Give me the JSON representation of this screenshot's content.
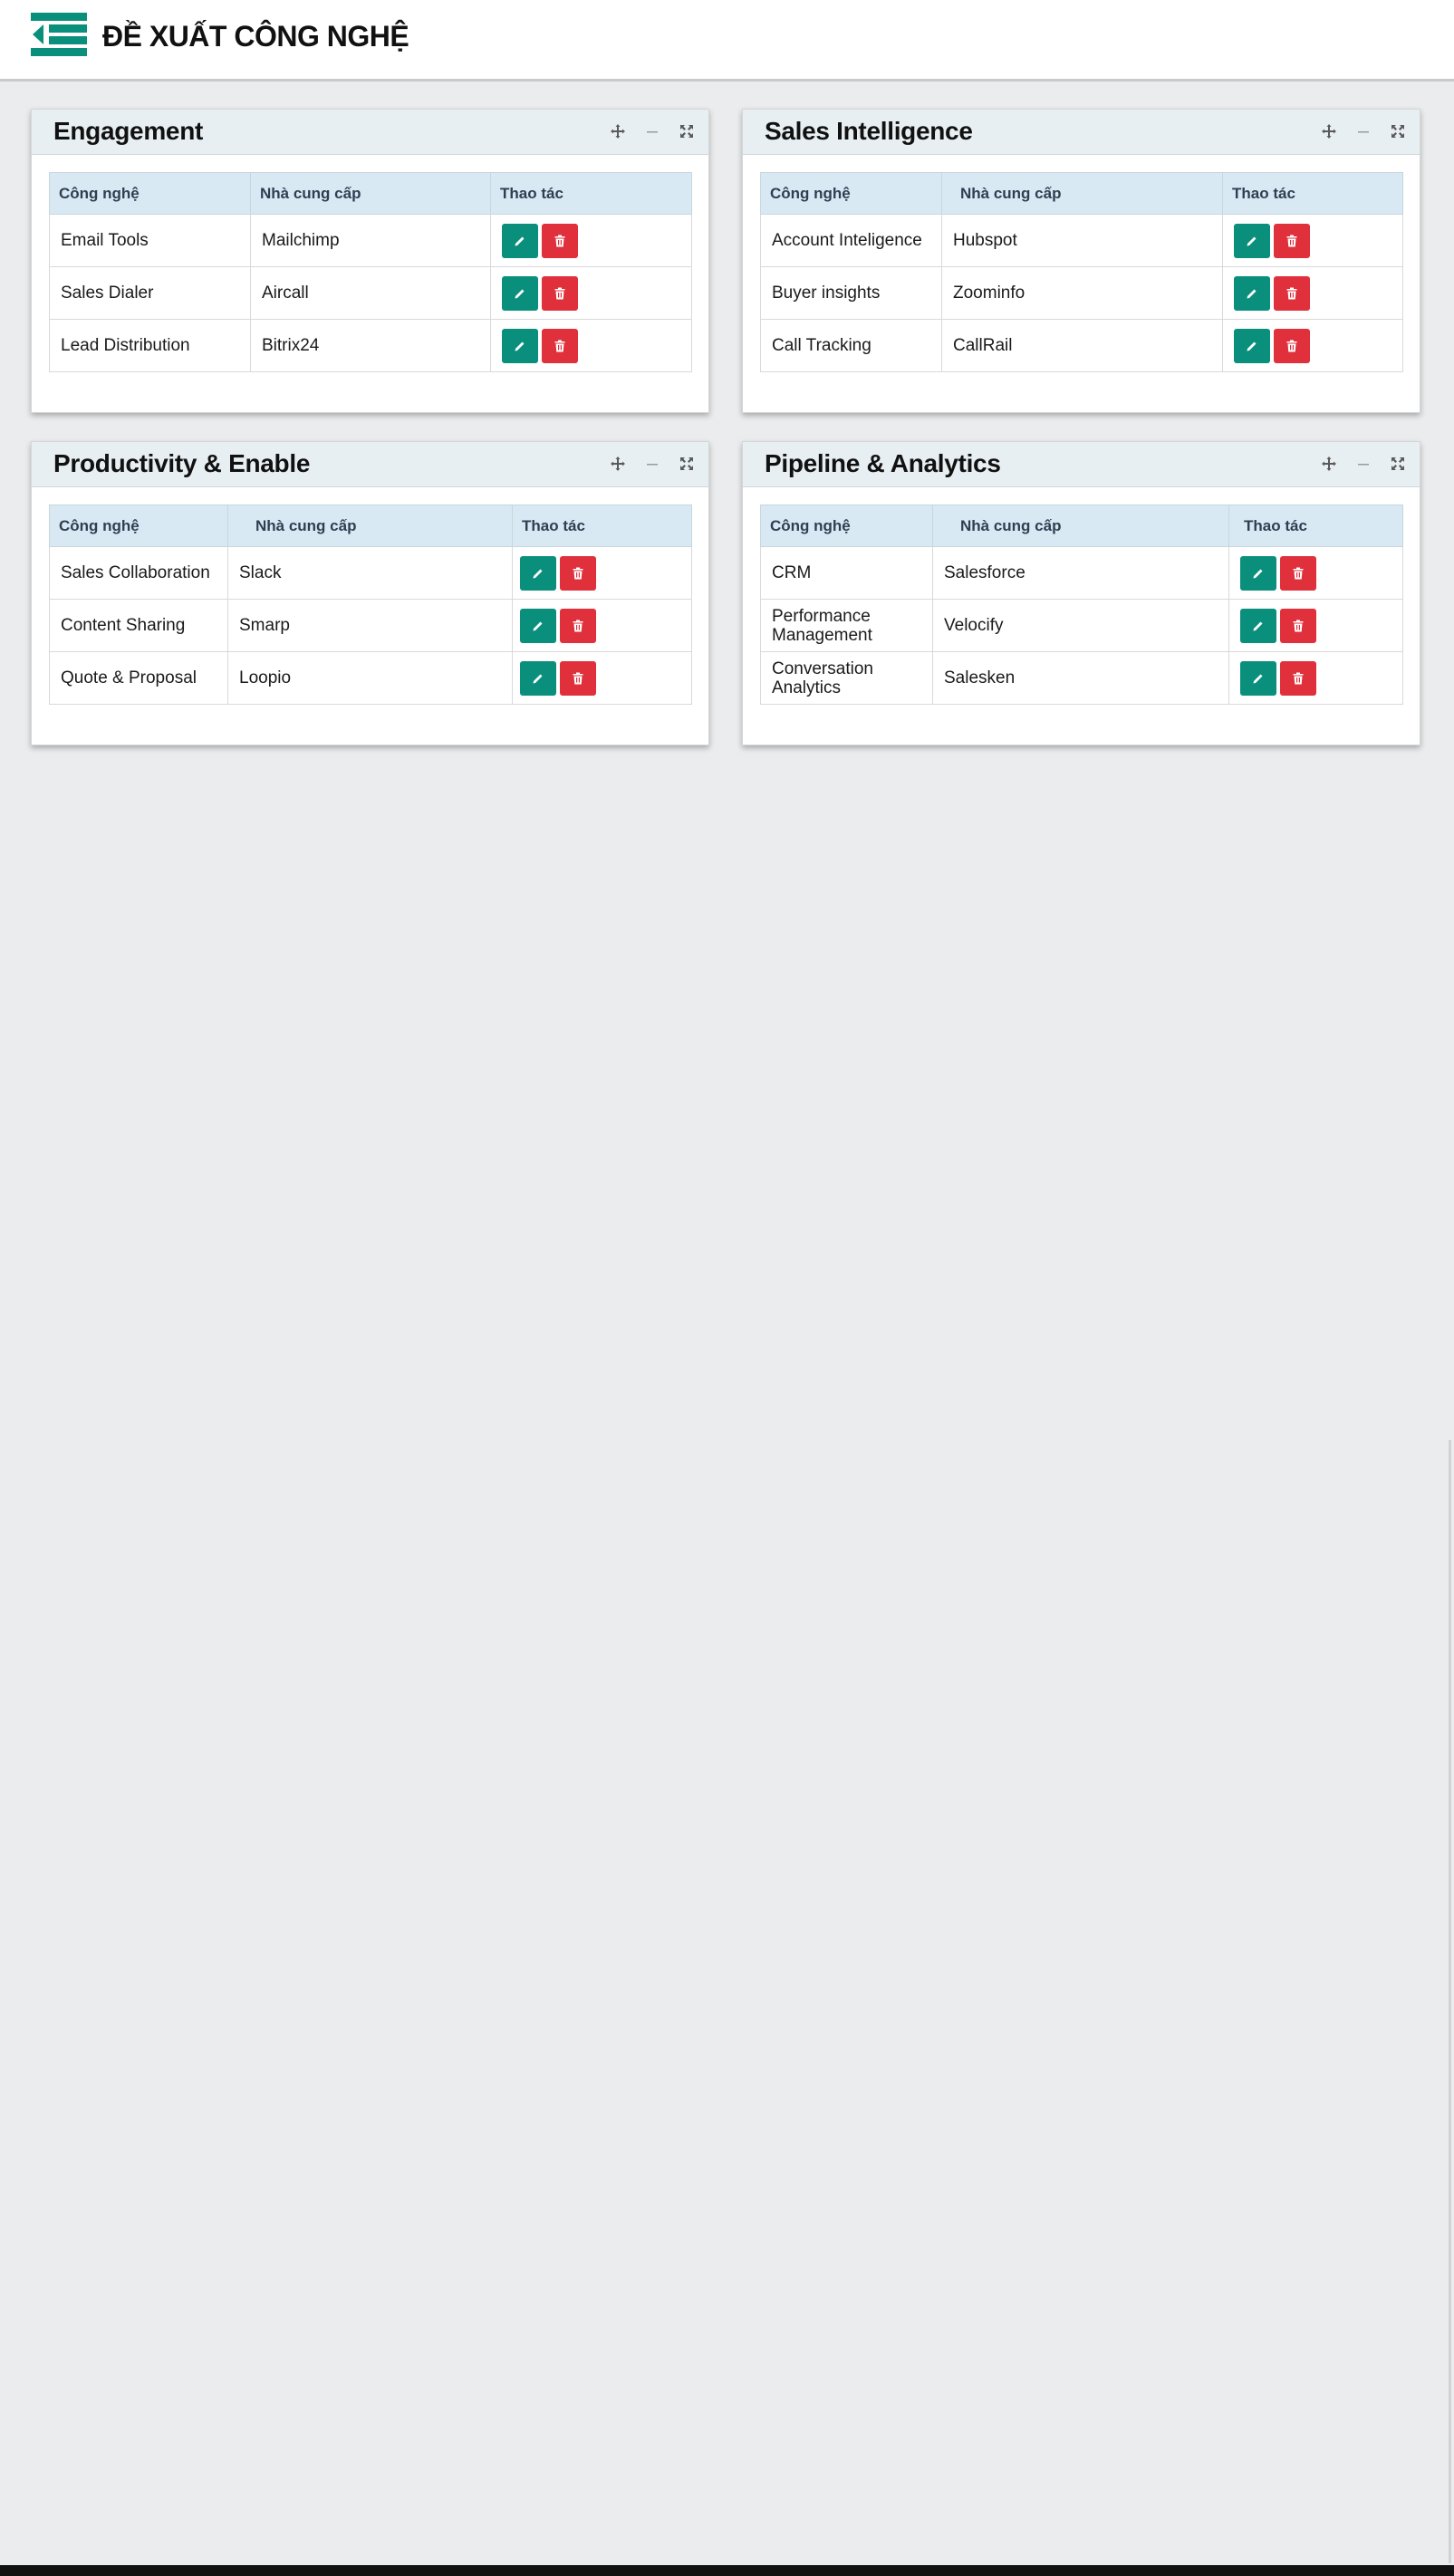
{
  "header": {
    "title": "ĐỀ XUẤT CÔNG NGHỆ",
    "menu_icon": "menu-collapse-icon",
    "accent_color": "#0a8f7d"
  },
  "table_columns": {
    "technology": "Công nghệ",
    "vendor": "Nhà cung cấp",
    "actions": "Thao tác"
  },
  "panels": [
    {
      "title": "Engagement",
      "rows": [
        {
          "technology": "Email Tools",
          "vendor": "Mailchimp"
        },
        {
          "technology": "Sales Dialer",
          "vendor": "Aircall"
        },
        {
          "technology": "Lead Distribution",
          "vendor": "Bitrix24"
        }
      ]
    },
    {
      "title": "Sales Intelligence",
      "rows": [
        {
          "technology": "Account Inteligence",
          "vendor": "Hubspot"
        },
        {
          "technology": "Buyer insights",
          "vendor": "Zoominfo"
        },
        {
          "technology": "Call Tracking",
          "vendor": "CallRail"
        }
      ]
    },
    {
      "title": "Productivity & Enable",
      "rows": [
        {
          "technology": "Sales Collaboration",
          "vendor": "Slack"
        },
        {
          "technology": "Content Sharing",
          "vendor": "Smarp"
        },
        {
          "technology": "Quote & Proposal",
          "vendor": "Loopio"
        }
      ]
    },
    {
      "title": "Pipeline & Analytics",
      "rows": [
        {
          "technology": "CRM",
          "vendor": "Salesforce"
        },
        {
          "technology": "Performance Management",
          "vendor": "Velocify"
        },
        {
          "technology": "Conversation Analytics",
          "vendor": "Salesken"
        }
      ]
    }
  ],
  "icons": {
    "move": "move-icon",
    "minimize": "minimize-icon",
    "expand": "expand-icon",
    "edit": "pencil-icon",
    "delete": "trash-icon"
  },
  "colors": {
    "edit_button": "#0a8f7d",
    "delete_button": "#e0303c",
    "table_header": "#d8e9f3",
    "panel_header": "#e8eff2",
    "page_background": "#ebecee"
  }
}
